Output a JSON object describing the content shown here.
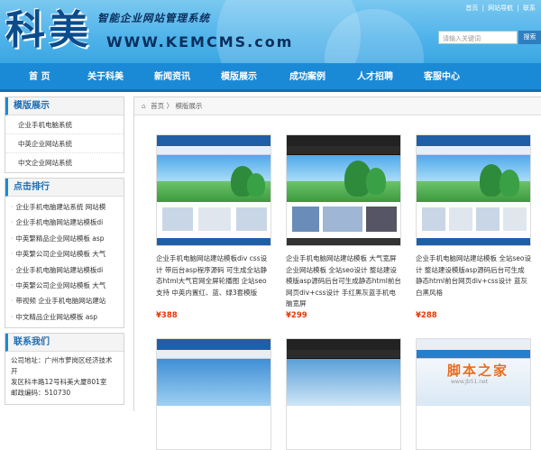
{
  "header": {
    "logo_chars": "科美",
    "subtitle": "智能企业网站管理系统",
    "url": "WWW.KEMCMS.com",
    "top_links": [
      "首页",
      "|",
      "网站导航",
      "|",
      "联系"
    ],
    "search_placeholder": "请输入关键词",
    "search_button": "搜索",
    "colors": {
      "header_bg": "#4fb3ea",
      "nav_bg": "#1b8ad6",
      "price": "#e03a00"
    }
  },
  "nav": {
    "items": [
      "首 页",
      "关于科美",
      "新闻资讯",
      "模版展示",
      "成功案例",
      "人才招聘",
      "客服中心"
    ]
  },
  "sidebar": {
    "templates": {
      "title": "模版展示",
      "items": [
        "企业手机电脑系统",
        "中英企业网站系统",
        "中文企业网站系统"
      ]
    },
    "ranking": {
      "title": "点击排行",
      "items": [
        "企业手机电脑建站系统 网站模",
        "企业手机电脑网站建站模板di",
        "中英繁精品企业网站模板 asp",
        "中英繁公司企业网站模板 大气",
        "企业手机电脑网站建站模板di",
        "中英繁公司企业网站模板 大气",
        "带视频 企业手机电脑网站建站",
        "中文精品企业网站模板 asp"
      ]
    },
    "contact": {
      "title": "联系我们",
      "lines": [
        "公司地址：广州市萝岗区经济技术开",
        "发区科丰路12号科美大厦801室",
        "邮政编码：510730"
      ]
    }
  },
  "main": {
    "breadcrumb": [
      "首页",
      "〉",
      "模版展示"
    ],
    "products": [
      {
        "title": "企业手机电脑网站建站模板div css设计 带后台asp程序源码 可生成全站静态html大气官网全屏轮播图 企站seo支持 中英内置红、蓝、绿3套模版",
        "price": "¥388",
        "theme": "light"
      },
      {
        "title": "企业手机电脑网站建站模板 大气宽屏企业网站模板 全站seo设计 整站建设模版asp源码后台可生成静态html前台网页div+css设计 手红黑灰蓝手机电脑宽屏",
        "price": "¥299",
        "theme": "dark"
      },
      {
        "title": "企业手机电脑网站建站模板 全站seo设计 整站建设模版asp源码后台可生成静态html前台网页div+css设计 蓝灰白黑风格",
        "price": "¥288",
        "theme": "light"
      },
      {
        "title": "",
        "price": "",
        "theme": "light"
      },
      {
        "title": "",
        "price": "",
        "theme": "dark"
      },
      {
        "title": "",
        "price": "",
        "theme": "light"
      }
    ]
  },
  "watermark": {
    "text": "脚本之家",
    "sub": "www.Jb51.net"
  }
}
